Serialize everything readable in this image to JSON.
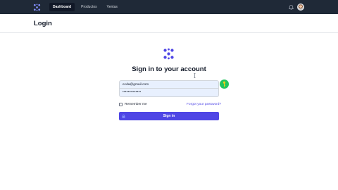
{
  "nav": {
    "items": [
      {
        "label": "Dashboard",
        "active": true
      },
      {
        "label": "Productos",
        "active": false
      },
      {
        "label": "Ventas",
        "active": false
      }
    ],
    "icons": {
      "logo": "logo-icon",
      "notifications": "bell-icon",
      "user": "avatar"
    }
  },
  "header": {
    "title": "Login"
  },
  "login": {
    "heading": "Sign in to your account",
    "email_value": "ecda@gmail.com",
    "password_value": "••••••••••••••",
    "remember_label": "Remember me",
    "forgot_label": "Forgot your password?",
    "submit_label": "Sign in",
    "remember_checked": false
  },
  "colors": {
    "navbar": "#1f2937",
    "accent": "#4f46e5",
    "autofill": "#e8f0fe",
    "key_badge": "#22c55e"
  }
}
